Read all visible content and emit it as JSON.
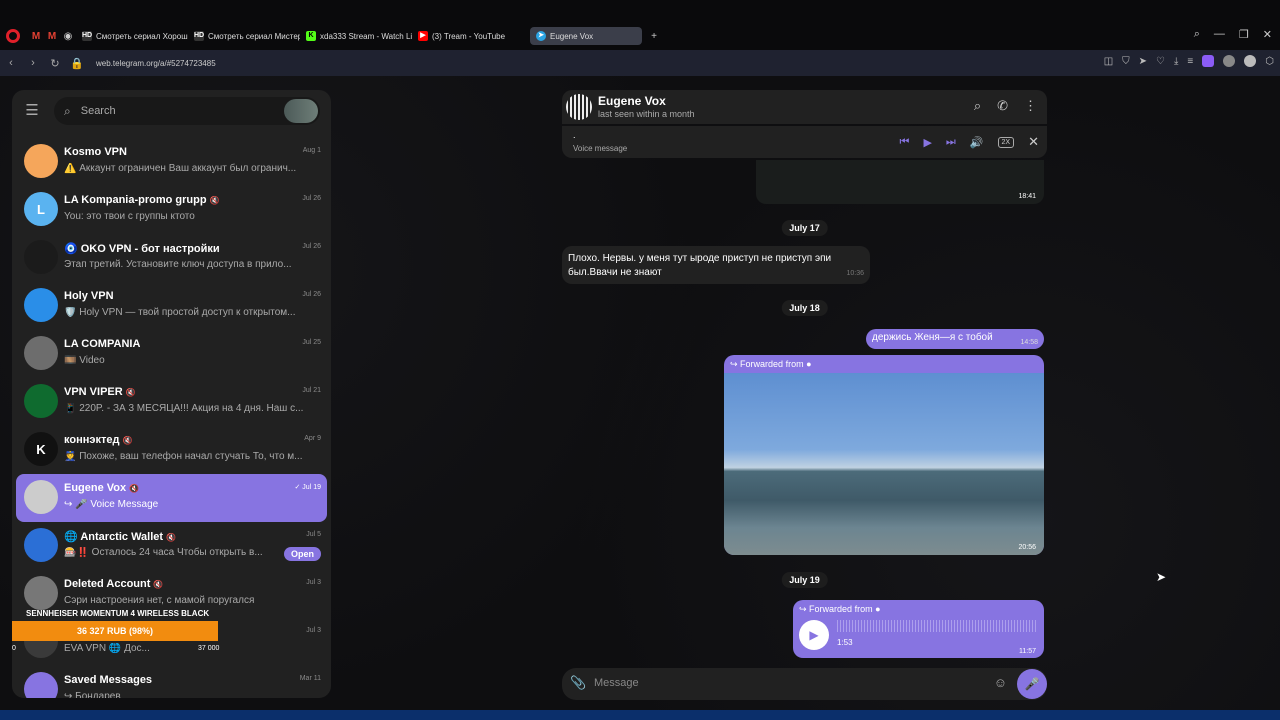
{
  "browser": {
    "tabs": [
      {
        "label": "",
        "icon": "gmail-icon",
        "color": "#e34133"
      },
      {
        "label": "",
        "icon": "gmail-icon",
        "color": "#e34133"
      },
      {
        "label": "",
        "icon": "chrome-icon",
        "color": "#888888"
      },
      {
        "label": "Смотреть сериал Хорош",
        "icon": "hd-icon",
        "color": "#333333"
      },
      {
        "label": "Смотреть сериал Мистер",
        "icon": "hd-icon",
        "color": "#333333"
      },
      {
        "label": "xda333 Stream - Watch Li",
        "icon": "kick-icon",
        "color": "#53fc18"
      },
      {
        "label": "(3) Tream - YouTube",
        "icon": "youtube-icon",
        "color": "#ff0000"
      },
      {
        "label": "Eugene Vox",
        "icon": "telegram-icon",
        "color": "#2aa3e3"
      }
    ],
    "url": "web.telegram.org/a/#5274723485"
  },
  "sidebar": {
    "search_placeholder": "Search",
    "chats": [
      {
        "name": "Kosmo VPN",
        "date": "Aug 1",
        "preview": "⚠️ Аккаунт ограничен Ваш аккаунт был огранич...",
        "avatar_color": "#f5a65b",
        "initial": "",
        "muted": false
      },
      {
        "name": "LA Kompania-promo grupp",
        "date": "Jul 26",
        "preview": "You: это твои с группы ктото",
        "avatar_color": "#5ab3f0",
        "initial": "L",
        "muted": true
      },
      {
        "name": "🧿 OKO VPN - бот настройки",
        "date": "Jul 26",
        "preview": "Этап третий. Установите ключ доступа в прило...",
        "avatar_color": "#1b1b1b",
        "initial": "",
        "muted": false
      },
      {
        "name": "Holy VPN",
        "date": "Jul 26",
        "preview": "🛡️ Holy VPN — твой простой доступ к открытом...",
        "avatar_color": "#2a8ee8",
        "initial": "",
        "muted": false
      },
      {
        "name": "LA COMPANIA",
        "date": "Jul 25",
        "preview": "🎞️ Video",
        "avatar_color": "#6d6d6d",
        "initial": "",
        "muted": false
      },
      {
        "name": "VPN VIPER",
        "date": "Jul 21",
        "preview": "📱 220P. - ЗА 3 МЕСЯЦА!!! Акция на 4 дня. Наш с...",
        "avatar_color": "#0f6b2f",
        "initial": "",
        "muted": true
      },
      {
        "name": "коннэктед",
        "date": "Apr 9",
        "preview": "👮 Похоже, ваш телефон начал стучать То, что м...",
        "avatar_color": "#111111",
        "initial": "K",
        "muted": true
      },
      {
        "name": "Eugene Vox",
        "date": "✓ Jul 19",
        "preview": "↪ 🎤 Voice Message",
        "avatar_color": "#cccccc",
        "initial": "",
        "muted": true,
        "active": true
      },
      {
        "name": "🌐 Antarctic Wallet",
        "date": "Jul 5",
        "preview": "🎰‼️ Осталось 24 часа Чтобы открыть в...",
        "avatar_color": "#2b6fd6",
        "initial": "",
        "muted": true,
        "open_label": "Open"
      },
      {
        "name": "Deleted Account",
        "date": "Jul 3",
        "preview": "Сэри настроения нет, с мамой поругался",
        "avatar_color": "#777777",
        "initial": "",
        "muted": true
      },
      {
        "name": "EVA VPN",
        "date": "Jul 3",
        "preview": "EVA VPN 🌐 Дос...",
        "avatar_color": "#3a3a3a",
        "initial": "",
        "muted": false
      },
      {
        "name": "Saved Messages",
        "date": "Mar 11",
        "preview": "↪ Бондарев",
        "avatar_color": "#8774e1",
        "initial": "",
        "muted": false
      }
    ]
  },
  "overlay": {
    "title": "SENNHEISER MOMENTUM 4 WIRELESS BLACK",
    "amount": "36 327 RUB (98%)",
    "progress_pct": 98,
    "left_label": "0",
    "right_label": "37 000"
  },
  "chat": {
    "title": "Eugene Vox",
    "status": "last seen within a month",
    "player_title": ".",
    "player_subtitle": "Voice message",
    "player_speed": "2X",
    "image_time": "18:41",
    "date1": "July 17",
    "msg_in": "Плохо. Нервы. у меня тут ыроде приступ не приступ эпи был.Ввачи не знают",
    "msg_in_time": "10:36",
    "date2": "July 18",
    "msg_out": "держись Женя—я с тобой",
    "msg_out_time": "14:58",
    "fwd_label": "Forwarded from",
    "photo_time": "20:56",
    "date3": "July 19",
    "voice_duration": "1:53",
    "voice_time": "11:57",
    "composer_placeholder": "Message"
  }
}
